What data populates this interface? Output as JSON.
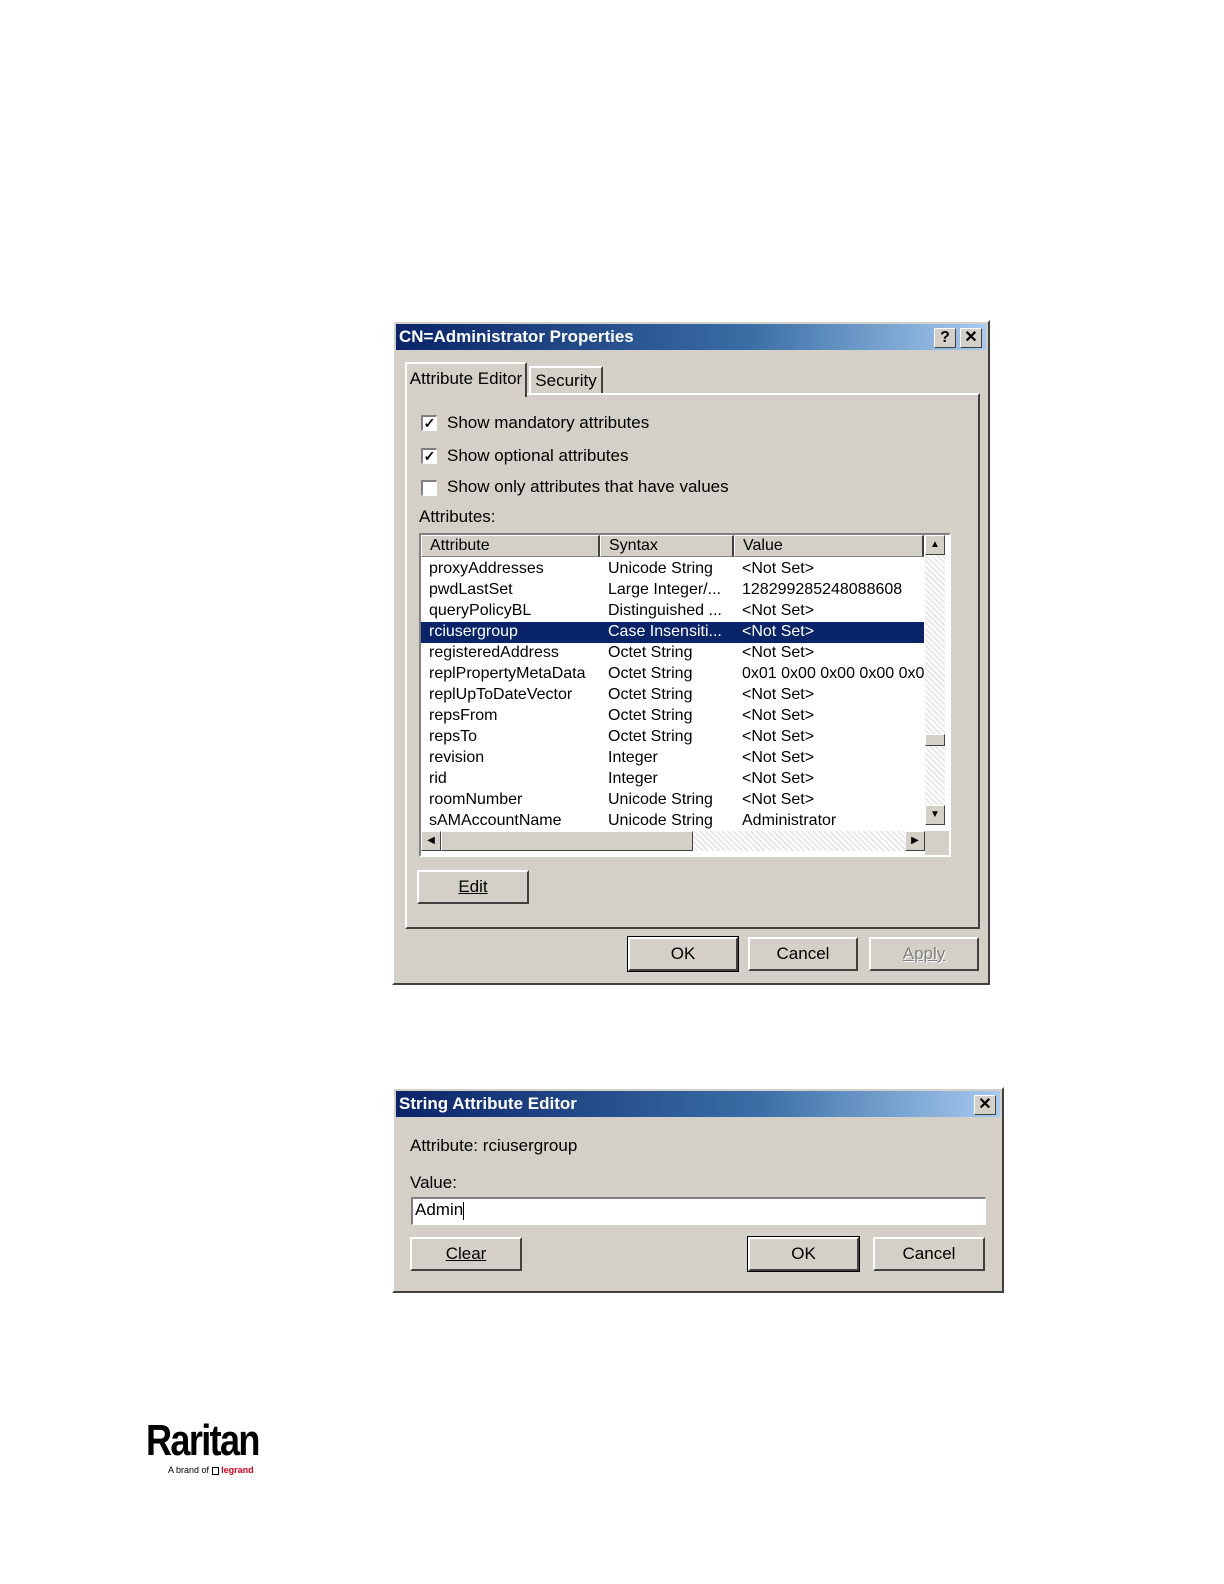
{
  "properties_dialog": {
    "title": "CN=Administrator Properties",
    "help_button": "?",
    "close_button": "✕",
    "tabs": [
      {
        "label": "Attribute Editor",
        "active": true
      },
      {
        "label": "Security",
        "active": false
      }
    ],
    "checkboxes": [
      {
        "label": "Show mandatory attributes",
        "checked": true
      },
      {
        "label": "Show optional attributes",
        "checked": true
      },
      {
        "label": "Show only attributes that have values",
        "checked": false
      }
    ],
    "attributes_label": "Attributes:",
    "columns": [
      "Attribute",
      "Syntax",
      "Value"
    ],
    "rows": [
      {
        "attribute": "proxyAddresses",
        "syntax": "Unicode String",
        "value": "<Not Set>"
      },
      {
        "attribute": "pwdLastSet",
        "syntax": "Large Integer/...",
        "value": "128299285248088608"
      },
      {
        "attribute": "queryPolicyBL",
        "syntax": "Distinguished ...",
        "value": "<Not Set>"
      },
      {
        "attribute": "rciusergroup",
        "syntax": "Case Insensiti...",
        "value": "<Not Set>",
        "selected": true
      },
      {
        "attribute": "registeredAddress",
        "syntax": "Octet String",
        "value": "<Not Set>"
      },
      {
        "attribute": "replPropertyMetaData",
        "syntax": "Octet String",
        "value": "0x01 0x00 0x00 0x00 0x0"
      },
      {
        "attribute": "replUpToDateVector",
        "syntax": "Octet String",
        "value": "<Not Set>"
      },
      {
        "attribute": "repsFrom",
        "syntax": "Octet String",
        "value": "<Not Set>"
      },
      {
        "attribute": "repsTo",
        "syntax": "Octet String",
        "value": "<Not Set>"
      },
      {
        "attribute": "revision",
        "syntax": "Integer",
        "value": "<Not Set>"
      },
      {
        "attribute": "rid",
        "syntax": "Integer",
        "value": "<Not Set>"
      },
      {
        "attribute": "roomNumber",
        "syntax": "Unicode String",
        "value": "<Not Set>"
      },
      {
        "attribute": "sAMAccountName",
        "syntax": "Unicode String",
        "value": "Administrator"
      }
    ],
    "edit_button": "Edit",
    "ok_button": "OK",
    "cancel_button": "Cancel",
    "apply_button": "Apply"
  },
  "string_editor": {
    "title": "String Attribute Editor",
    "close_button": "✕",
    "attribute_label": "Attribute:",
    "attribute_name": "rciusergroup",
    "value_label": "Value:",
    "value": "Admin",
    "clear_button": "Clear",
    "ok_button": "OK",
    "cancel_button": "Cancel"
  },
  "logo": {
    "brand": "Raritan",
    "tagline_prefix": "A brand of",
    "tagline_brand": "legrand",
    "brand_color": "#000000",
    "tagline_color": "#e2001a"
  }
}
